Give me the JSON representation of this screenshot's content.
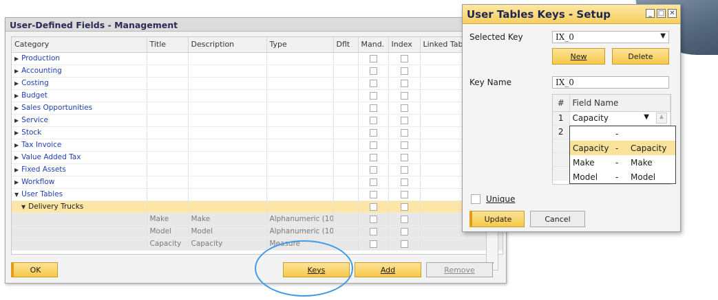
{
  "udf_window": {
    "title": "User-Defined Fields - Management",
    "columns": [
      "Category",
      "Title",
      "Description",
      "Type",
      "Dflt",
      "Mand.",
      "Index",
      "Linked Table"
    ],
    "categories": [
      {
        "label": "Production"
      },
      {
        "label": "Accounting"
      },
      {
        "label": "Costing"
      },
      {
        "label": "Budget"
      },
      {
        "label": "Sales Opportunities"
      },
      {
        "label": "Service"
      },
      {
        "label": "Stock"
      },
      {
        "label": "Tax Invoice"
      },
      {
        "label": "Value Added Tax"
      },
      {
        "label": "Fixed Assets"
      },
      {
        "label": "Workflow"
      }
    ],
    "user_tables_label": "User Tables",
    "delivery_trucks_label": "Delivery Trucks",
    "fields": [
      {
        "title": "Make",
        "description": "Make",
        "type": "Alphanumeric (10"
      },
      {
        "title": "Model",
        "description": "Model",
        "type": "Alphanumeric (10"
      },
      {
        "title": "Capacity",
        "description": "Capacity",
        "type": "Measure"
      }
    ],
    "buttons": {
      "ok": "OK",
      "keys": "Keys",
      "add": "Add",
      "remove": "Remove"
    }
  },
  "keys_window": {
    "title": "User Tables Keys - Setup",
    "selected_key_label": "Selected Key",
    "selected_key_value": "IX_0",
    "new_button": "New",
    "delete_button": "Delete",
    "key_name_label": "Key Name",
    "key_name_value": "IX_0",
    "grid_columns": [
      "#",
      "Field Name"
    ],
    "grid_rows": [
      {
        "num": "1",
        "field": "Capacity"
      },
      {
        "num": "2",
        "field": ""
      }
    ],
    "dropdown_options": [
      {
        "alias": "",
        "sep": "-",
        "desc": ""
      },
      {
        "alias": "Capacity",
        "sep": "-",
        "desc": "Capacity"
      },
      {
        "alias": "Make",
        "sep": "-",
        "desc": "Make"
      },
      {
        "alias": "Model",
        "sep": "-",
        "desc": "Model"
      }
    ],
    "unique_label": "Unique",
    "update_button": "Update",
    "cancel_button": "Cancel"
  }
}
